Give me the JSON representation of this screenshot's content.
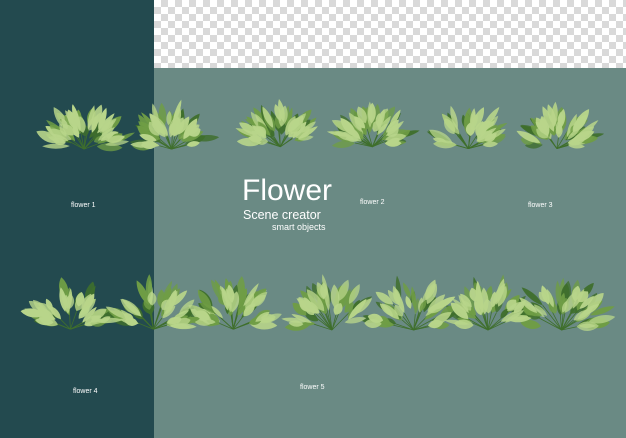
{
  "title": "Flower",
  "subtitle": "Scene creator",
  "tagline": "smart objects",
  "labels": {
    "flower_1": "flower 1",
    "flower_2": "flower 2",
    "flower_3": "flower 3",
    "flower_4": "flower 4",
    "flower_5": "flower 5"
  },
  "colors": {
    "left_panel": "#234a4f",
    "main_background": "#6a8a84",
    "leaf_dark": "#3f6f2c",
    "leaf_mid": "#6f9d45",
    "leaf_light": "#b8d58a",
    "text": "#ffffff"
  }
}
